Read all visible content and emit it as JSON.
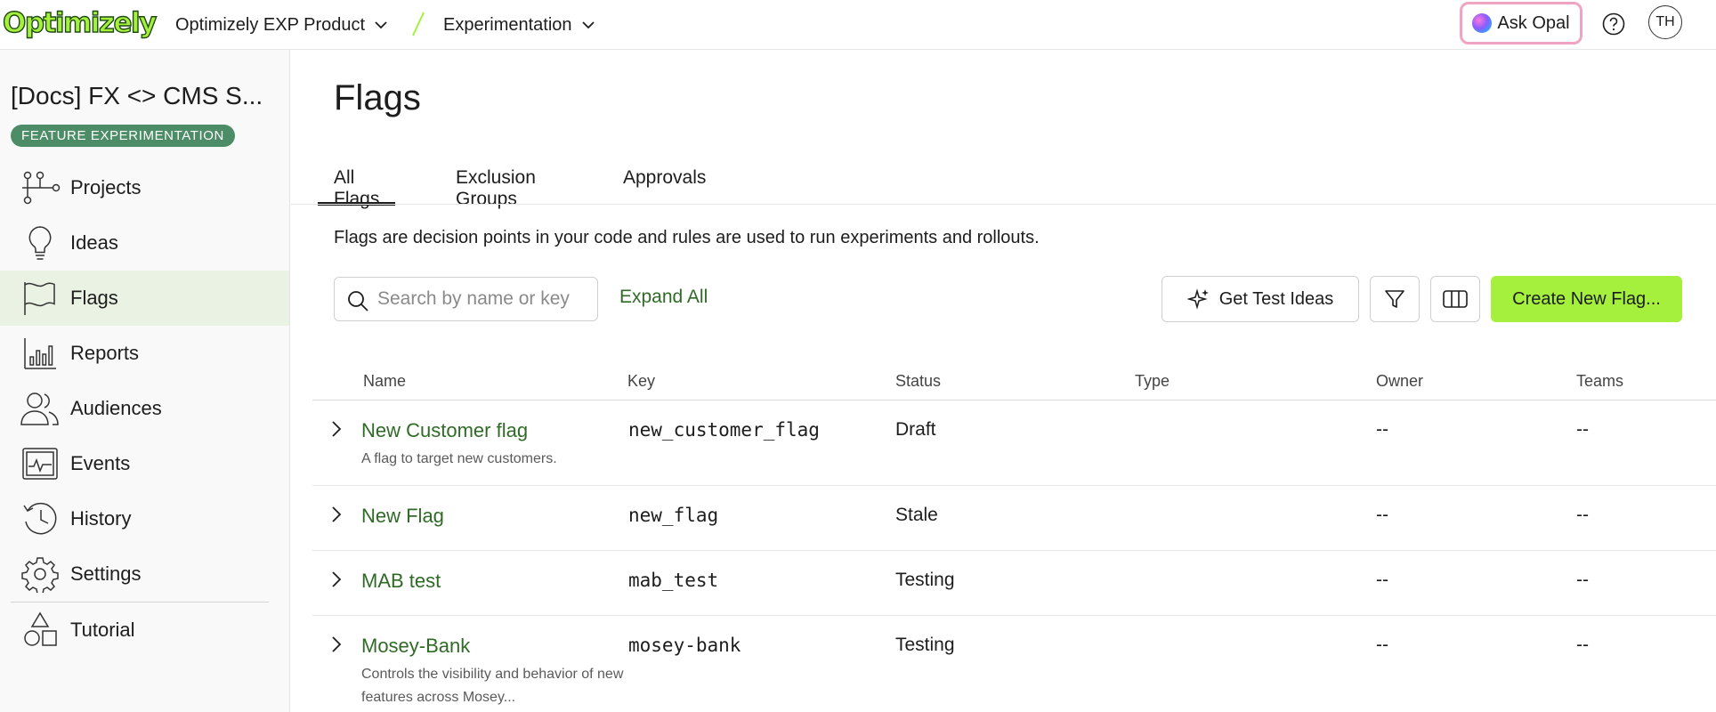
{
  "brand": {
    "logo_text": "Optimizely",
    "accent": "#a4f03c",
    "link_green": "#2f6b26"
  },
  "topbar": {
    "product_select": "Optimizely EXP Product",
    "section_select": "Experimentation",
    "ask_opal": "Ask Opal",
    "help_icon": "question-circle-icon",
    "avatar_initials": "TH"
  },
  "sidebar": {
    "project_name": "[Docs] FX <> CMS S...",
    "product_badge": "FEATURE EXPERIMENTATION",
    "items": [
      {
        "label": "Projects",
        "icon": "projects-icon"
      },
      {
        "label": "Ideas",
        "icon": "lightbulb-icon"
      },
      {
        "label": "Flags",
        "icon": "flag-icon",
        "active": true
      },
      {
        "label": "Reports",
        "icon": "bar-chart-icon"
      },
      {
        "label": "Audiences",
        "icon": "users-icon"
      },
      {
        "label": "Events",
        "icon": "events-icon"
      },
      {
        "label": "History",
        "icon": "history-icon"
      },
      {
        "label": "Settings",
        "icon": "gear-icon"
      },
      {
        "label": "Tutorial",
        "icon": "shapes-icon"
      }
    ]
  },
  "main": {
    "title": "Flags",
    "tabs": [
      {
        "label": "All Flags",
        "active": true
      },
      {
        "label": "Exclusion Groups"
      },
      {
        "label": "Approvals"
      }
    ],
    "intro": "Flags are decision points in your code and rules are used to run experiments and rollouts.",
    "search_placeholder": "Search by name or key",
    "expand_all": "Expand All",
    "get_test_ideas": "Get Test Ideas",
    "create_flag": "Create New Flag...",
    "table": {
      "headers": [
        "Name",
        "Key",
        "Status",
        "Type",
        "Owner",
        "Teams"
      ],
      "rows": [
        {
          "name": "New Customer flag",
          "description": "A flag to target new customers.",
          "key": "new_customer_flag",
          "status": "Draft",
          "type": "",
          "owner": "--",
          "teams": "--"
        },
        {
          "name": "New Flag",
          "description": "",
          "key": "new_flag",
          "status": "Stale",
          "type": "",
          "owner": "--",
          "teams": "--"
        },
        {
          "name": "MAB test",
          "description": "",
          "key": "mab_test",
          "status": "Testing",
          "type": "",
          "owner": "--",
          "teams": "--"
        },
        {
          "name": "Mosey-Bank",
          "description": "Controls the visibility and behavior of new features across Mosey...",
          "key": "mosey-bank",
          "status": "Testing",
          "type": "",
          "owner": "--",
          "teams": "--"
        }
      ]
    }
  }
}
